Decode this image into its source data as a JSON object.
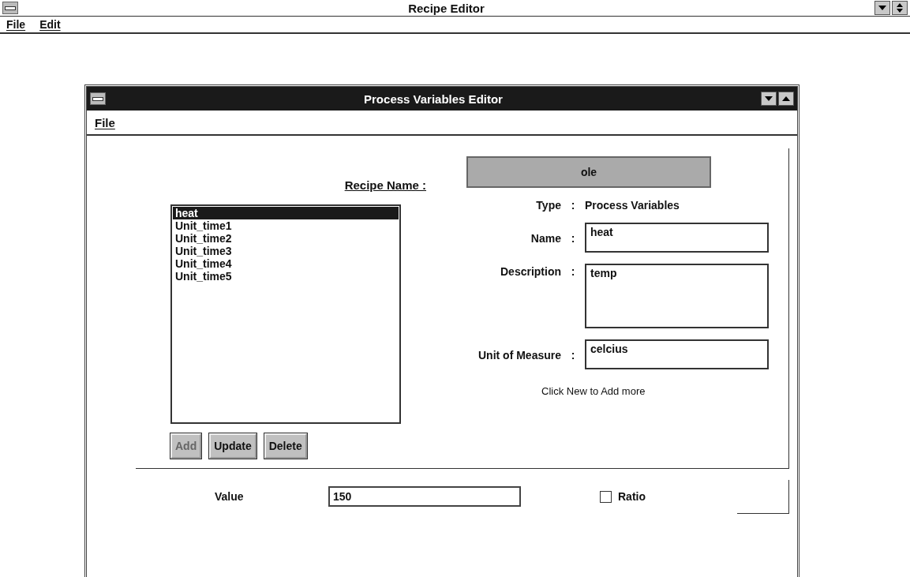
{
  "window": {
    "title": "Recipe Editor"
  },
  "menu": [
    {
      "label": "File"
    },
    {
      "label": "Edit"
    }
  ],
  "dialog": {
    "title": "Process Variables Editor",
    "menu": [
      {
        "label": "File"
      }
    ],
    "recipe_name_label": "Recipe Name :",
    "recipe_name": "ole",
    "variables": [
      {
        "label": "heat",
        "selected": true
      },
      {
        "label": "Unit_time1",
        "selected": false
      },
      {
        "label": "Unit_time2",
        "selected": false
      },
      {
        "label": "Unit_time3",
        "selected": false
      },
      {
        "label": "Unit_time4",
        "selected": false
      },
      {
        "label": "Unit_time5",
        "selected": false
      }
    ],
    "buttons": [
      {
        "label": "Add",
        "disabled": true
      },
      {
        "label": "Update",
        "disabled": false
      },
      {
        "label": "Delete",
        "disabled": false
      }
    ],
    "fields": [
      {
        "kind": "static",
        "label": "Type",
        "colon": ":",
        "value": "Process Variables"
      },
      {
        "kind": "input",
        "label": "Name",
        "colon": ":",
        "value": "heat"
      },
      {
        "kind": "textarea",
        "label": "Description",
        "colon": ":",
        "value": "temp"
      },
      {
        "kind": "input",
        "label": "Unit of Measure",
        "colon": ":",
        "value": "celcius"
      }
    ],
    "hint": "Click New to Add more",
    "value_label": "Value",
    "value": "150",
    "ratio": {
      "label": "Ratio",
      "checked": false
    }
  }
}
